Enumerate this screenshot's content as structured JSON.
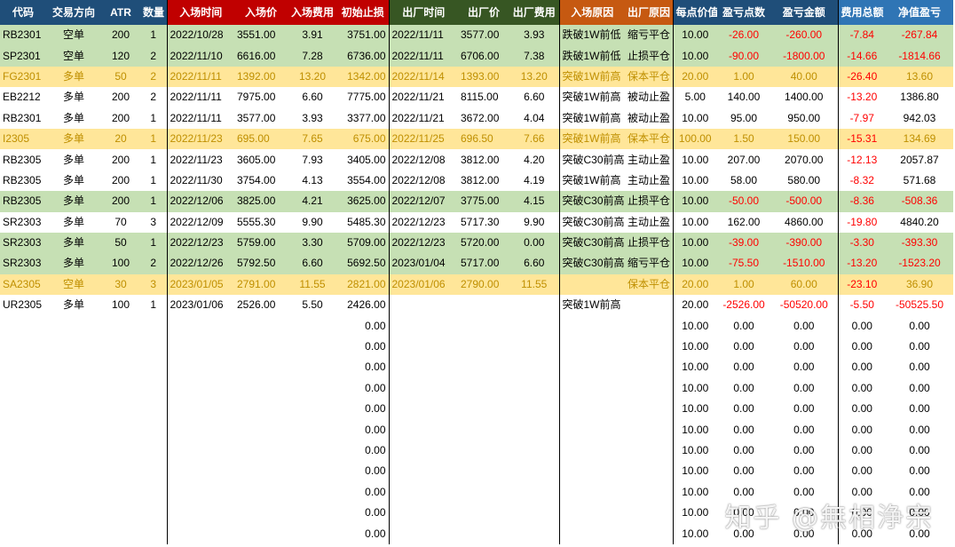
{
  "headers": [
    {
      "label": "代码",
      "cls": "hb"
    },
    {
      "label": "交易方向",
      "cls": "hb"
    },
    {
      "label": "ATR",
      "cls": "hb"
    },
    {
      "label": "数量",
      "cls": "hb"
    },
    {
      "label": "入场时间",
      "cls": "hr"
    },
    {
      "label": "入场价",
      "cls": "hr"
    },
    {
      "label": "入场费用",
      "cls": "hr"
    },
    {
      "label": "初始止损",
      "cls": "hr"
    },
    {
      "label": "出厂时间",
      "cls": "hg"
    },
    {
      "label": "出厂价",
      "cls": "hg"
    },
    {
      "label": "出厂费用",
      "cls": "hg"
    },
    {
      "label": "入场原因",
      "cls": "ho"
    },
    {
      "label": "出厂原因",
      "cls": "ho"
    },
    {
      "label": "每点价值",
      "cls": "hb"
    },
    {
      "label": "盈亏点数",
      "cls": "hb"
    },
    {
      "label": "盈亏金额",
      "cls": "hb"
    },
    {
      "label": "费用总额",
      "cls": "hb2"
    },
    {
      "label": "净值盈亏",
      "cls": "hb2"
    }
  ],
  "rows": [
    {
      "style": "green",
      "cells": [
        "RB2301",
        "空单",
        "200",
        "1",
        "2022/10/28",
        "3551.00",
        "3.91",
        "3751.00",
        "2022/11/11",
        "3577.00",
        "3.93",
        "跌破1W前低",
        "缩亏平仓",
        "10.00",
        "-26.00",
        "-260.00",
        "-7.84",
        "-267.84"
      ],
      "red": [
        14,
        15,
        16,
        17
      ]
    },
    {
      "style": "green",
      "cells": [
        "SP2301",
        "空单",
        "120",
        "2",
        "2022/11/10",
        "6616.00",
        "7.28",
        "6736.00",
        "2022/11/11",
        "6706.00",
        "7.38",
        "跌破1W前低",
        "止损平仓",
        "10.00",
        "-90.00",
        "-1800.00",
        "-14.66",
        "-1814.66"
      ],
      "red": [
        14,
        15,
        16,
        17
      ]
    },
    {
      "style": "yellow",
      "cells": [
        "FG2301",
        "多单",
        "50",
        "2",
        "2022/11/11",
        "1392.00",
        "13.20",
        "1342.00",
        "2022/11/14",
        "1393.00",
        "13.20",
        "突破1W前高",
        "保本平仓",
        "20.00",
        "1.00",
        "40.00",
        "-26.40",
        "13.60"
      ],
      "red": [
        16
      ]
    },
    {
      "style": "",
      "cells": [
        "EB2212",
        "多单",
        "200",
        "2",
        "2022/11/11",
        "7975.00",
        "6.60",
        "7775.00",
        "2022/11/21",
        "8115.00",
        "6.60",
        "突破1W前高",
        "被动止盈",
        "5.00",
        "140.00",
        "1400.00",
        "-13.20",
        "1386.80"
      ],
      "red": [
        16
      ]
    },
    {
      "style": "",
      "cells": [
        "RB2301",
        "多单",
        "200",
        "1",
        "2022/11/11",
        "3577.00",
        "3.93",
        "3377.00",
        "2022/11/21",
        "3672.00",
        "4.04",
        "突破1W前高",
        "被动止盈",
        "10.00",
        "95.00",
        "950.00",
        "-7.97",
        "942.03"
      ],
      "red": [
        16
      ]
    },
    {
      "style": "yellow",
      "cells": [
        "I2305",
        "多单",
        "20",
        "1",
        "2022/11/23",
        "695.00",
        "7.65",
        "675.00",
        "2022/11/25",
        "696.50",
        "7.66",
        "突破1W前高",
        "保本平仓",
        "100.00",
        "1.50",
        "150.00",
        "-15.31",
        "134.69"
      ],
      "red": [
        16
      ]
    },
    {
      "style": "",
      "cells": [
        "RB2305",
        "多单",
        "200",
        "1",
        "2022/11/23",
        "3605.00",
        "7.93",
        "3405.00",
        "2022/12/08",
        "3812.00",
        "4.20",
        "突破C30前高",
        "主动止盈",
        "10.00",
        "207.00",
        "2070.00",
        "-12.13",
        "2057.87"
      ],
      "red": [
        16
      ]
    },
    {
      "style": "",
      "cells": [
        "RB2305",
        "多单",
        "200",
        "1",
        "2022/11/30",
        "3754.00",
        "4.13",
        "3554.00",
        "2022/12/08",
        "3812.00",
        "4.19",
        "突破1W前高",
        "主动止盈",
        "10.00",
        "58.00",
        "580.00",
        "-8.32",
        "571.68"
      ],
      "red": [
        16
      ]
    },
    {
      "style": "green",
      "cells": [
        "RB2305",
        "多单",
        "200",
        "1",
        "2022/12/06",
        "3825.00",
        "4.21",
        "3625.00",
        "2022/12/07",
        "3775.00",
        "4.15",
        "突破C30前高",
        "止损平仓",
        "10.00",
        "-50.00",
        "-500.00",
        "-8.36",
        "-508.36"
      ],
      "red": [
        14,
        15,
        16,
        17
      ]
    },
    {
      "style": "",
      "cells": [
        "SR2303",
        "多单",
        "70",
        "3",
        "2022/12/09",
        "5555.30",
        "9.90",
        "5485.30",
        "2022/12/23",
        "5717.30",
        "9.90",
        "突破C30前高",
        "主动止盈",
        "10.00",
        "162.00",
        "4860.00",
        "-19.80",
        "4840.20"
      ],
      "red": [
        16
      ]
    },
    {
      "style": "green",
      "cells": [
        "SR2303",
        "多单",
        "50",
        "1",
        "2022/12/23",
        "5759.00",
        "3.30",
        "5709.00",
        "2022/12/23",
        "5720.00",
        "0.00",
        "突破C30前高",
        "止损平仓",
        "10.00",
        "-39.00",
        "-390.00",
        "-3.30",
        "-393.30"
      ],
      "red": [
        14,
        15,
        16,
        17
      ]
    },
    {
      "style": "green",
      "cells": [
        "SR2303",
        "多单",
        "100",
        "2",
        "2022/12/26",
        "5792.50",
        "6.60",
        "5692.50",
        "2023/01/04",
        "5717.00",
        "6.60",
        "突破C30前高",
        "缩亏平仓",
        "10.00",
        "-75.50",
        "-1510.00",
        "-13.20",
        "-1523.20"
      ],
      "red": [
        14,
        15,
        16,
        17
      ]
    },
    {
      "style": "yellow",
      "cells": [
        "SA2305",
        "空单",
        "30",
        "3",
        "2023/01/05",
        "2791.00",
        "11.55",
        "2821.00",
        "2023/01/06",
        "2790.00",
        "11.55",
        "",
        "保本平仓",
        "20.00",
        "1.00",
        "60.00",
        "-23.10",
        "36.90"
      ],
      "red": [
        16
      ]
    },
    {
      "style": "",
      "cells": [
        "UR2305",
        "多单",
        "100",
        "1",
        "2023/01/06",
        "2526.00",
        "5.50",
        "2426.00",
        "",
        "",
        "",
        "突破1W前高",
        "",
        "20.00",
        "-2526.00",
        "-50520.00",
        "-5.50",
        "-50525.50"
      ],
      "red": [
        14,
        15,
        16,
        17
      ]
    }
  ],
  "zero_rows": 11,
  "zero_value": "0.00",
  "default_point_value": "10.00",
  "watermark": "知乎 @無相浄宗"
}
